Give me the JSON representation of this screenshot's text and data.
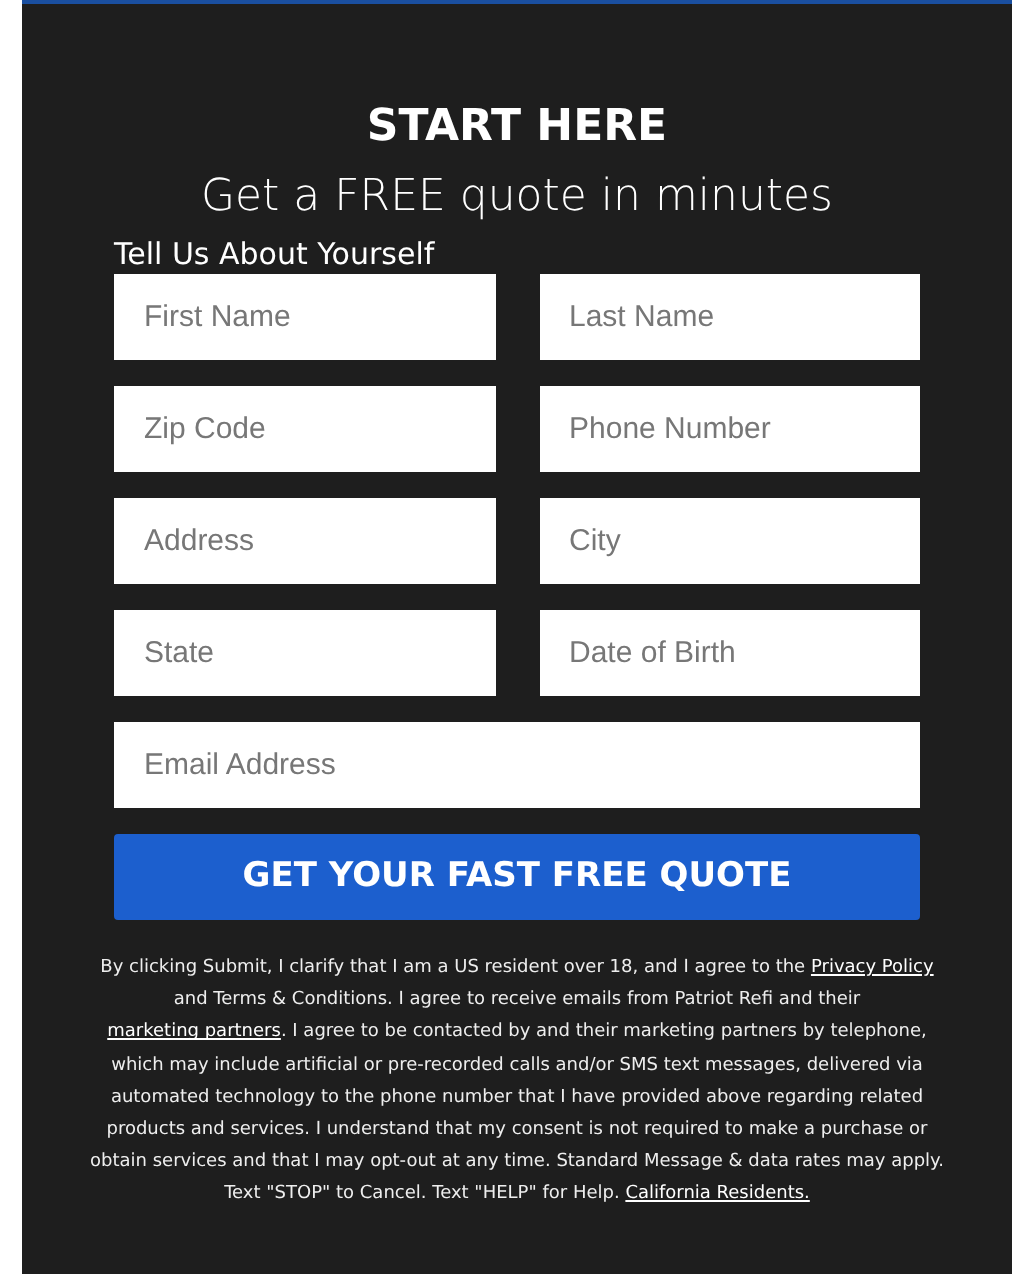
{
  "heading": "START HERE",
  "subheading": "Get a FREE quote in minutes",
  "section_label": "Tell Us About Yourself",
  "fields": [
    {
      "placeholder": "First Name",
      "kind": "half"
    },
    {
      "placeholder": "Last Name",
      "kind": "half"
    },
    {
      "placeholder": "Zip Code",
      "kind": "half"
    },
    {
      "placeholder": "Phone Number",
      "kind": "half"
    },
    {
      "placeholder": "Address",
      "kind": "half"
    },
    {
      "placeholder": "City",
      "kind": "half"
    },
    {
      "placeholder": "State",
      "kind": "half"
    },
    {
      "placeholder": "Date of Birth",
      "kind": "half"
    },
    {
      "placeholder": "Email Address",
      "kind": "full"
    }
  ],
  "submit_button": "GET YOUR FAST FREE QUOTE",
  "disclaimer": [
    {
      "kind": "text",
      "text": "By clicking Submit, I clarify that I am a US resident over 18, and I agree to the "
    },
    {
      "kind": "link",
      "text": "Privacy Policy"
    },
    {
      "kind": "text",
      "text": " and Terms & Conditions. I agree to receive emails from Patriot Refi and their "
    },
    {
      "kind": "link",
      "text": "marketing partners"
    },
    {
      "kind": "text",
      "text": ". I agree to be contacted by and their marketing partners by telephone, which may include artificial or pre-recorded calls and/or SMS text messages, delivered via automated technology to the phone number that I have provided above regarding related products and services. I understand that my consent is not required to make a purchase or obtain services and that I may opt-out at any time. Standard Message & data rates may apply. Text \"STOP\" to Cancel. Text \"HELP\"  for Help. "
    },
    {
      "kind": "link",
      "text": "California Residents."
    }
  ]
}
